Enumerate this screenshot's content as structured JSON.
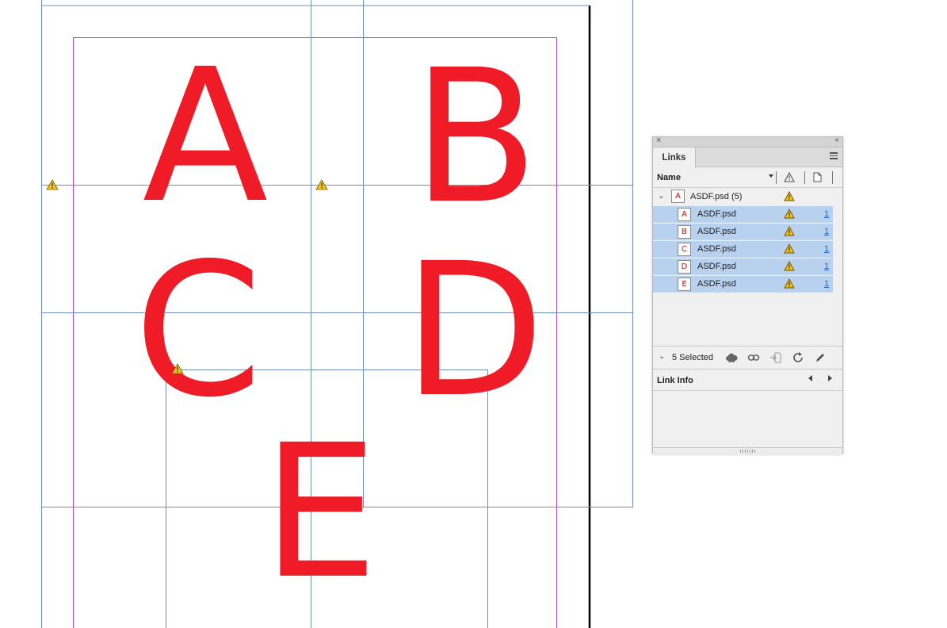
{
  "document": {
    "letters": [
      "A",
      "B",
      "C",
      "D",
      "E"
    ],
    "letter_color": "#ef1c27",
    "guide_color": "#6e8fb6",
    "margin_color": "#a84ccb",
    "warning_color": "#f2c21a"
  },
  "links_panel": {
    "tab_label": "Links",
    "column_name": "Name",
    "parent": {
      "filename": "ASDF.psd (5)",
      "thumb": "A"
    },
    "rows": [
      {
        "filename": "ASDF.psd",
        "thumb": "A",
        "page": "1"
      },
      {
        "filename": "ASDF.psd",
        "thumb": "B",
        "page": "1"
      },
      {
        "filename": "ASDF.psd",
        "thumb": "C",
        "page": "1"
      },
      {
        "filename": "ASDF.psd",
        "thumb": "D",
        "page": "1"
      },
      {
        "filename": "ASDF.psd",
        "thumb": "E",
        "page": "1"
      }
    ],
    "selected_label": "5 Selected",
    "link_info_label": "Link Info",
    "selection_color": "#b7d1ef",
    "icons": [
      "close-icon",
      "collapse-icon",
      "panel-menu-icon",
      "warning-icon",
      "page-icon",
      "cloud-icon",
      "relink-icon",
      "goto-link-icon",
      "update-link-icon",
      "edit-original-icon",
      "chevron-left-icon",
      "chevron-right-icon"
    ]
  }
}
